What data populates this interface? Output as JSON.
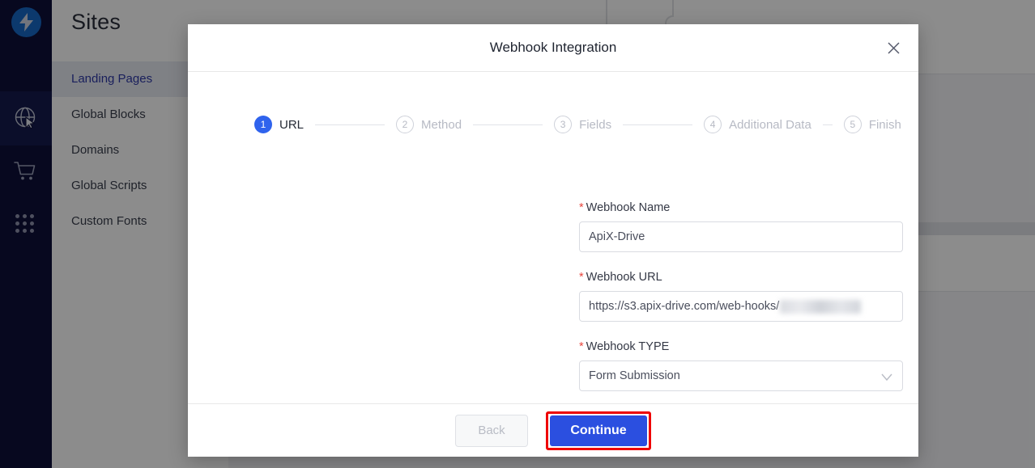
{
  "app": {
    "rail": {
      "logo_icon": "lightning-bolt-icon",
      "items": [
        {
          "icon": "globe-cursor-icon",
          "name": "sites",
          "active": true
        },
        {
          "icon": "shopping-cart-icon",
          "name": "ecommerce",
          "active": false
        },
        {
          "icon": "apps-grid-icon",
          "name": "apps",
          "active": false
        }
      ]
    },
    "sidebar": {
      "title": "Sites",
      "items": [
        {
          "label": "Landing Pages",
          "active": true
        },
        {
          "label": "Global Blocks",
          "active": false
        },
        {
          "label": "Domains",
          "active": false
        },
        {
          "label": "Global Scripts",
          "active": false
        },
        {
          "label": "Custom Fonts",
          "active": false
        }
      ]
    },
    "background": {
      "puzzle_icon": "puzzle-piece-icon"
    }
  },
  "modal": {
    "title": "Webhook Integration",
    "close_icon": "close-icon",
    "stepper": [
      {
        "number": "1",
        "label": "URL",
        "state": "done"
      },
      {
        "number": "2",
        "label": "Method",
        "state": "todo"
      },
      {
        "number": "3",
        "label": "Fields",
        "state": "todo"
      },
      {
        "number": "4",
        "label": "Additional Data",
        "state": "todo"
      },
      {
        "number": "5",
        "label": "Finish",
        "state": "todo"
      }
    ],
    "form": {
      "name": {
        "label": "Webhook Name",
        "required_marker": "*",
        "value": "ApiX-Drive"
      },
      "url": {
        "label": "Webhook URL",
        "required_marker": "*",
        "value": "https://s3.apix-drive.com/web-hooks/",
        "redacted": true
      },
      "type": {
        "label": "Webhook TYPE",
        "required_marker": "*",
        "value": "Form Submission",
        "chevron_icon": "chevron-down-icon"
      }
    },
    "footer": {
      "back_label": "Back",
      "continue_label": "Continue"
    }
  },
  "colors": {
    "rail_bg": "#0d1039",
    "rail_active": "#141a4e",
    "accent_blue": "#2f63ed",
    "continue_blue": "#2b4fe0",
    "annotation_red": "#ee0000",
    "required_red": "#e8453c",
    "sidebar_active_text": "#2f3aa8"
  }
}
